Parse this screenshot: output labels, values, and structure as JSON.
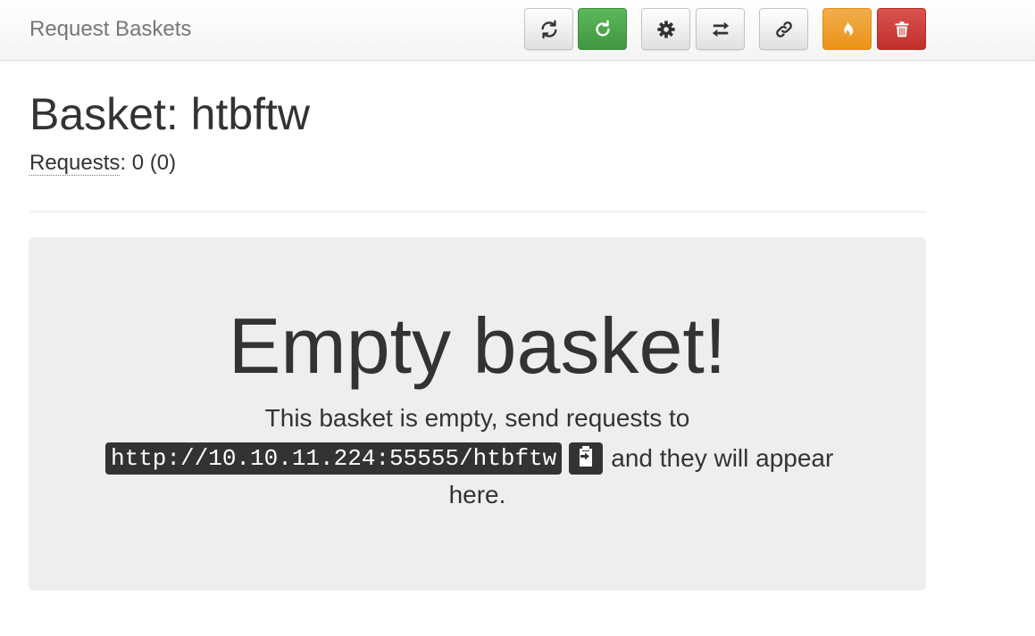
{
  "navbar": {
    "brand": "Request Baskets",
    "buttons": [
      {
        "name": "refresh-button",
        "icon": "refresh-icon",
        "style": "default"
      },
      {
        "name": "auto-refresh-button",
        "icon": "redo-icon",
        "style": "green"
      },
      {
        "name": "settings-button",
        "icon": "gear-icon",
        "style": "default"
      },
      {
        "name": "responses-button",
        "icon": "transfer-icon",
        "style": "default"
      },
      {
        "name": "share-link-button",
        "icon": "link-icon",
        "style": "default"
      },
      {
        "name": "clear-requests-button",
        "icon": "fire-icon",
        "style": "orange"
      },
      {
        "name": "delete-basket-button",
        "icon": "trash-icon",
        "style": "red"
      }
    ]
  },
  "basket": {
    "title": "Basket: htbftw",
    "requests_label": "Requests",
    "requests_count": ": 0 (0)"
  },
  "empty": {
    "heading": "Empty basket!",
    "line1": "This basket is empty, send requests to",
    "url": "http://10.10.11.224:55555/htbftw",
    "after_url": "and they will appear",
    "line3": "here."
  },
  "colors": {
    "green": "#5cb85c",
    "orange": "#f0ad4e",
    "red": "#d9534f",
    "jumbotron_bg": "#eeeeee",
    "code_bg": "#333333"
  }
}
